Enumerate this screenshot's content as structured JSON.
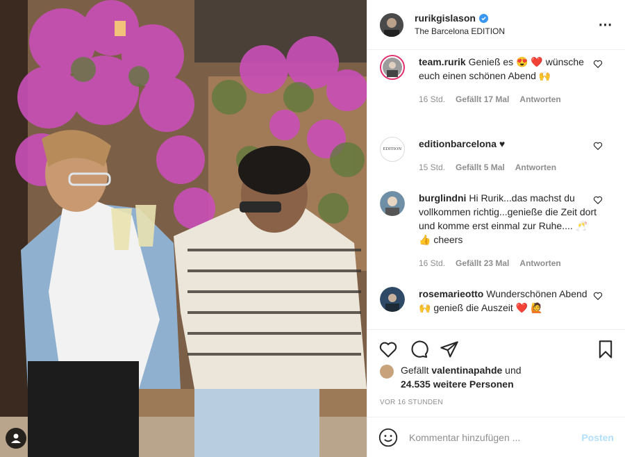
{
  "post": {
    "username": "rurikgislason",
    "location": "The Barcelona EDITION",
    "more_icon": "⋯"
  },
  "comments": [
    {
      "username": "team.rurik",
      "text": "Genieß es 😍 ❤️ wünsche euch einen schönen Abend 🙌",
      "time": "16 Std.",
      "likes": "Gefällt 17 Mal",
      "reply": "Antworten"
    },
    {
      "username": "editionbarcelona",
      "text": "♥",
      "time": "15 Std.",
      "likes": "Gefällt 5 Mal",
      "reply": "Antworten",
      "avatar_text": "EDITION"
    },
    {
      "username": "burglindni",
      "text": "Hi Rurik...das machst du vollkommen richtig...genieße die Zeit dort und komme erst einmal zur Ruhe.... 🥂 👍 cheers",
      "time": "16 Std.",
      "likes": "Gefällt 23 Mal",
      "reply": "Antworten"
    },
    {
      "username": "rosemarieotto",
      "text": "Wunderschönen Abend 🙌 genieß die Auszeit ❤️ 🙋",
      "time": "",
      "likes": "",
      "reply": ""
    }
  ],
  "likes": {
    "prefix": "Gefällt",
    "user": "valentinapahde",
    "joiner": "und",
    "count": "24.535 weitere Personen"
  },
  "timestamp": "VOR 16 STUNDEN",
  "add_comment": {
    "placeholder": "Kommentar hinzufügen ...",
    "post_label": "Posten"
  },
  "colors": {
    "verified": "#3897f0",
    "post_button": "#b2dffc",
    "meta": "#8e8e8e"
  }
}
